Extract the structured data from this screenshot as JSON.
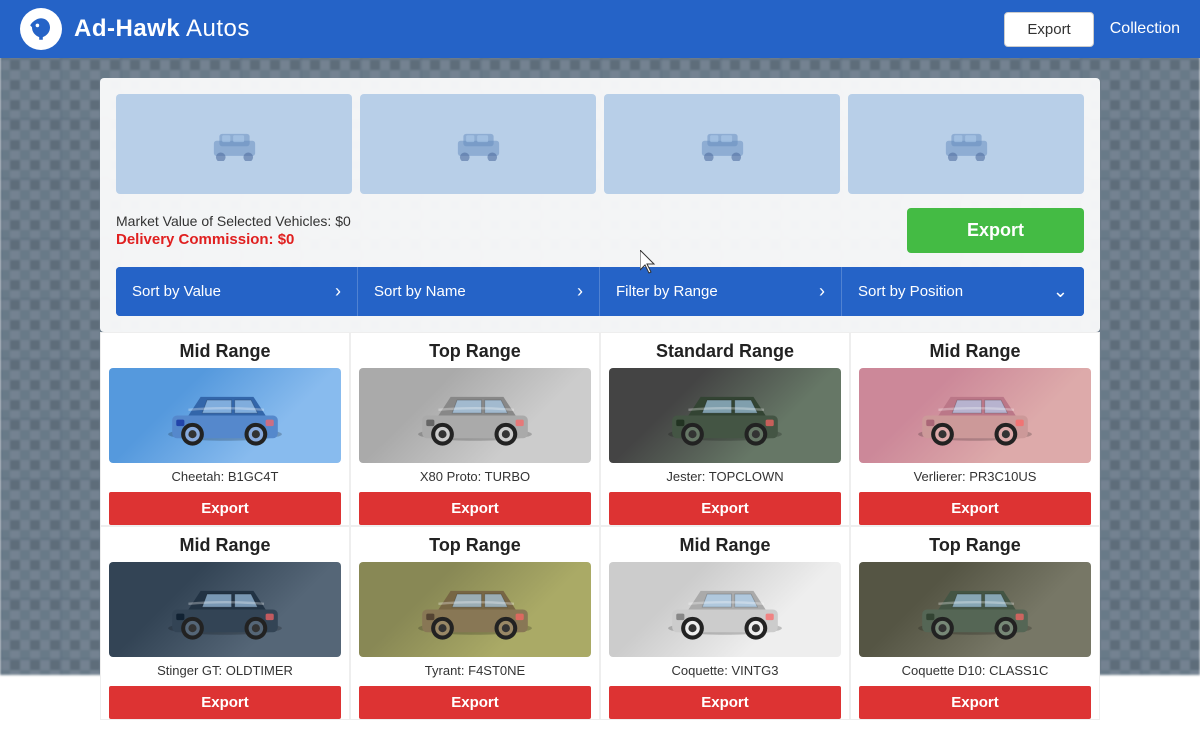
{
  "header": {
    "title_bold": "Ad-Hawk",
    "title_light": " Autos",
    "export_label": "Export",
    "collection_label": "Collection"
  },
  "selected_area": {
    "market_value_label": "Market Value of Selected Vehicles: $0",
    "delivery_commission_label": "Delivery Commission: $0",
    "export_label": "Export",
    "slots": [
      {
        "id": 1
      },
      {
        "id": 2
      },
      {
        "id": 3
      },
      {
        "id": 4
      }
    ]
  },
  "filter_bar": {
    "sort_value": "Sort by Value",
    "sort_name": "Sort by Name",
    "filter_range": "Filter by Range",
    "sort_position": "Sort by Position"
  },
  "vehicles": [
    {
      "range": "Mid Range",
      "name": "Cheetah: B1GC4T",
      "color": "car-blue",
      "export_label": "Export"
    },
    {
      "range": "Top Range",
      "name": "X80 Proto: TURBO",
      "color": "car-silver",
      "export_label": "Export"
    },
    {
      "range": "Standard Range",
      "name": "Jester: TOPCLOWN",
      "color": "car-darkgreen",
      "export_label": "Export"
    },
    {
      "range": "Mid Range",
      "name": "Verlierer: PR3C10US",
      "color": "car-pink",
      "export_label": "Export"
    },
    {
      "range": "Mid Range",
      "name": "Stinger GT: OLDTIMER",
      "color": "car-darkblue",
      "export_label": "Export"
    },
    {
      "range": "Top Range",
      "name": "Tyrant: F4ST0NE",
      "color": "car-olive",
      "export_label": "Export"
    },
    {
      "range": "Mid Range",
      "name": "Coquette: VINTG3",
      "color": "car-white",
      "export_label": "Export"
    },
    {
      "range": "Top Range",
      "name": "Coquette D10: CLASS1C",
      "color": "car-darkgray",
      "export_label": "Export"
    }
  ]
}
